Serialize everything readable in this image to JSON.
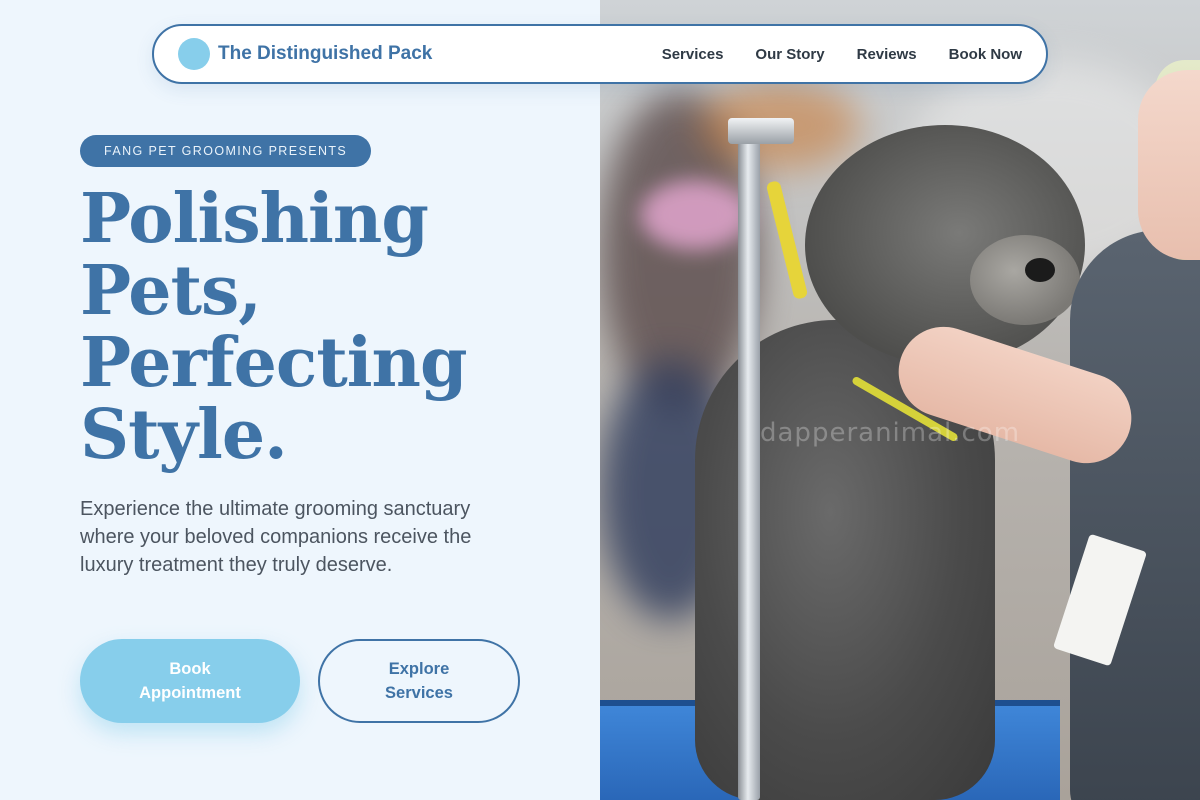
{
  "nav": {
    "brand": "The Distinguished Pack",
    "links": [
      "Services",
      "Our Story",
      "Reviews",
      "Book Now"
    ]
  },
  "hero": {
    "badge": "FANG PET GROOMING PRESENTS",
    "headline_lines": [
      "Polishing",
      "Pets,",
      "Perfecting",
      "Style."
    ],
    "subtext": "Experience the ultimate grooming sanctuary where your beloved companions receive the luxury treatment they truly deserve.",
    "primary_button": "Book Appointment",
    "secondary_button": "Explore Services"
  },
  "photo": {
    "watermark": "dapperanimal.com"
  },
  "colors": {
    "accent": "#3f73a6",
    "light_accent": "#87ceeb",
    "background": "#eef6fd"
  }
}
